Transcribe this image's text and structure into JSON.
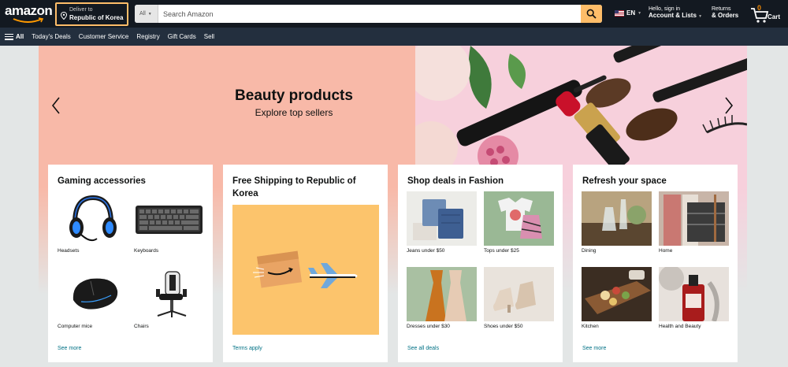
{
  "header": {
    "logo_text": "amazon",
    "deliver_line1": "Deliver to",
    "deliver_line2": "Republic of Korea",
    "search_category": "All",
    "search_placeholder": "Search Amazon",
    "lang": "EN",
    "account_line1": "Hello, sign in",
    "account_line2": "Account & Lists",
    "returns_line1": "Returns",
    "returns_line2": "& Orders",
    "cart_count": "0",
    "cart_label": "Cart"
  },
  "subnav": {
    "all_label": "All",
    "items": [
      "Today's Deals",
      "Customer Service",
      "Registry",
      "Gift Cards",
      "Sell"
    ]
  },
  "hero": {
    "title": "Beauty products",
    "subtitle": "Explore top sellers"
  },
  "cards": [
    {
      "title": "Gaming accessories",
      "tiles": [
        "Headsets",
        "Keyboards",
        "Computer mice",
        "Chairs"
      ],
      "link": "See more"
    },
    {
      "title": "Free Shipping to Republic of Korea",
      "link": "Terms apply"
    },
    {
      "title": "Shop deals in Fashion",
      "tiles": [
        "Jeans under $50",
        "Tops under $25",
        "Dresses under $30",
        "Shoes under $50"
      ],
      "link": "See all deals"
    },
    {
      "title": "Refresh your space",
      "tiles": [
        "Dining",
        "Home",
        "Kitchen",
        "Health and Beauty"
      ],
      "link": "See more"
    }
  ],
  "colors": {
    "nav_top": "#131921",
    "nav_sub": "#232f3e",
    "accent": "#febd69",
    "link": "#007185"
  }
}
